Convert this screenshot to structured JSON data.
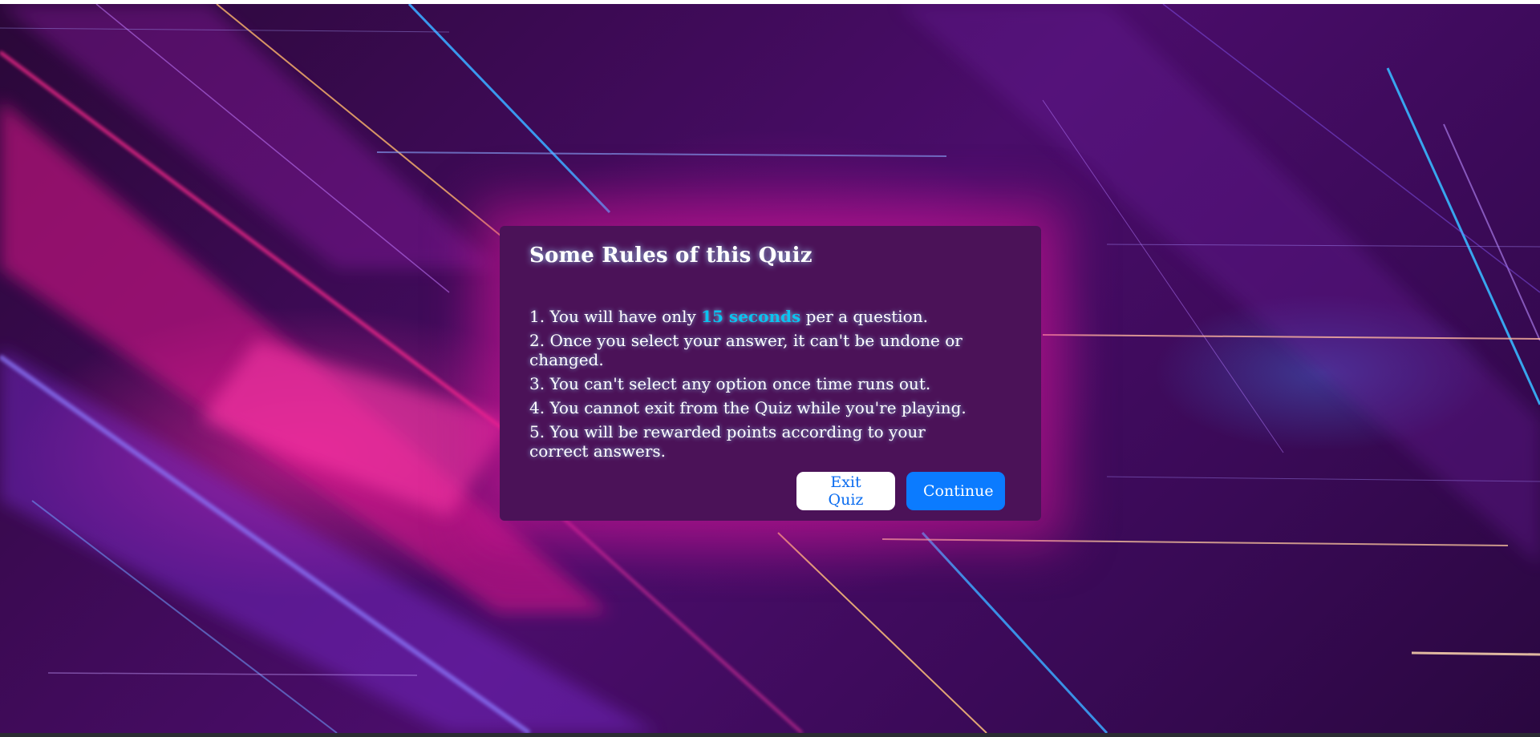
{
  "modal": {
    "title": "Some Rules of this Quiz",
    "rules": [
      {
        "number": "1.",
        "before": "You will have only",
        "highlight": "15 seconds",
        "after": "per a question."
      },
      {
        "number": "2.",
        "text": "Once you select your answer, it can't be undone or changed."
      },
      {
        "number": "3.",
        "text": "You can't select any option once time runs out."
      },
      {
        "number": "4.",
        "text": "You cannot exit from the Quiz while you're playing."
      },
      {
        "number": "5.",
        "text": "You will be rewarded points according to your correct answers."
      }
    ],
    "buttons": {
      "exit_label": "Exit Quiz",
      "continue_label": "Continue"
    }
  },
  "colors": {
    "modal_bg": "#4b1258",
    "glow": "#d61496",
    "highlight": "#0ac3f0",
    "continue_bg": "#0b7bff",
    "exit_text": "#0a6cf0"
  }
}
